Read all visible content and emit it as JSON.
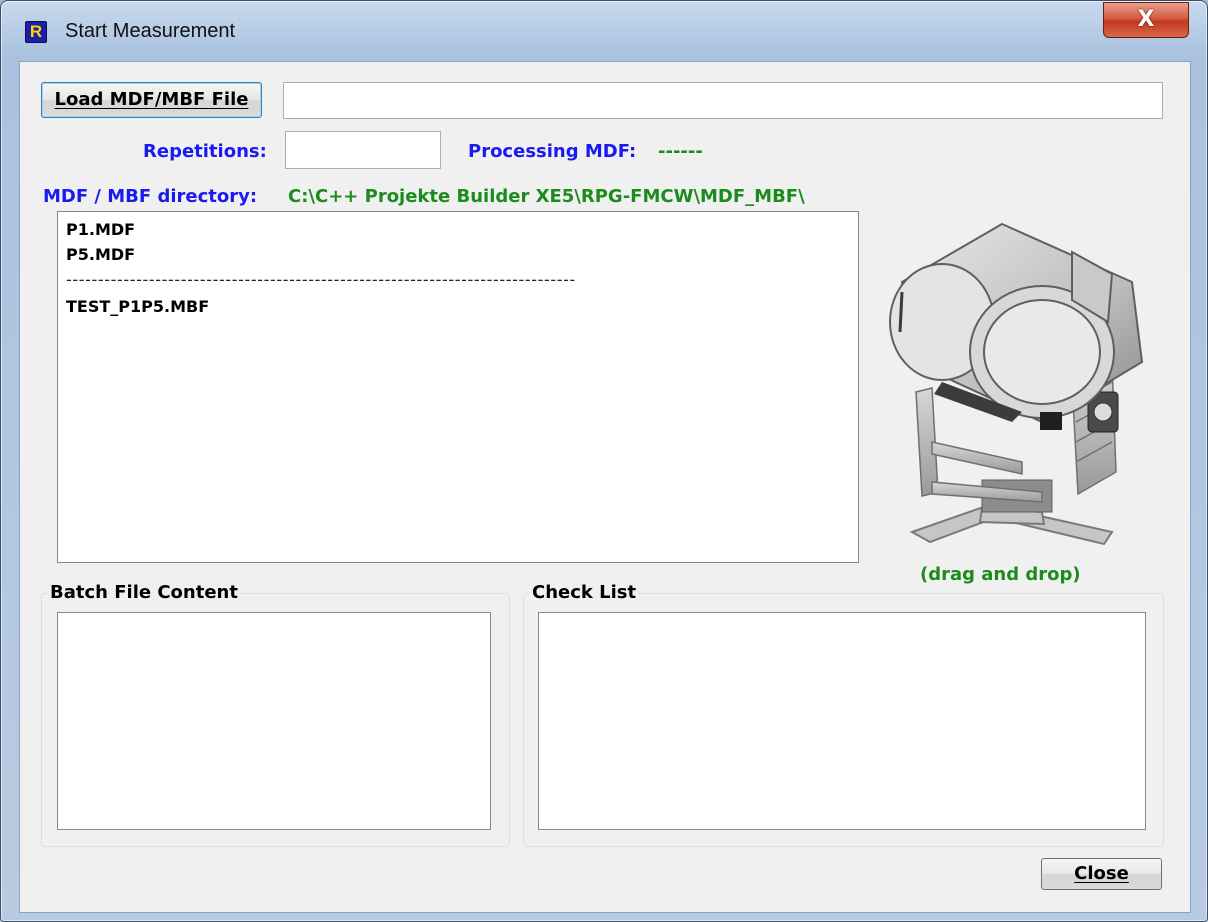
{
  "window": {
    "title": "Start Measurement",
    "app_icon_glyph": "R",
    "close_glyph": "X"
  },
  "load": {
    "button_label": "Load MDF/MBF File",
    "file_path_value": ""
  },
  "repetitions": {
    "label": "Repetitions:",
    "value": ""
  },
  "processing": {
    "label": "Processing MDF:",
    "value": "------"
  },
  "directory": {
    "label": "MDF / MBF directory:",
    "path": "C:\\C++ Projekte Builder XE5\\RPG-FMCW\\MDF_MBF\\"
  },
  "file_list": {
    "items": [
      "P1.MDF",
      "P5.MDF",
      "--------------------------------------------------------------------------------",
      "TEST_P1P5.MBF"
    ]
  },
  "image_caption": "(drag and drop)",
  "batch_group": {
    "title": "Batch File Content"
  },
  "check_group": {
    "title": "Check List"
  },
  "footer": {
    "close_label": "Close"
  },
  "colors": {
    "label_blue": "#1a1af0",
    "label_green": "#1b8c1b"
  },
  "icons": [
    "app-icon",
    "window-close-icon",
    "radiometer-image"
  ]
}
